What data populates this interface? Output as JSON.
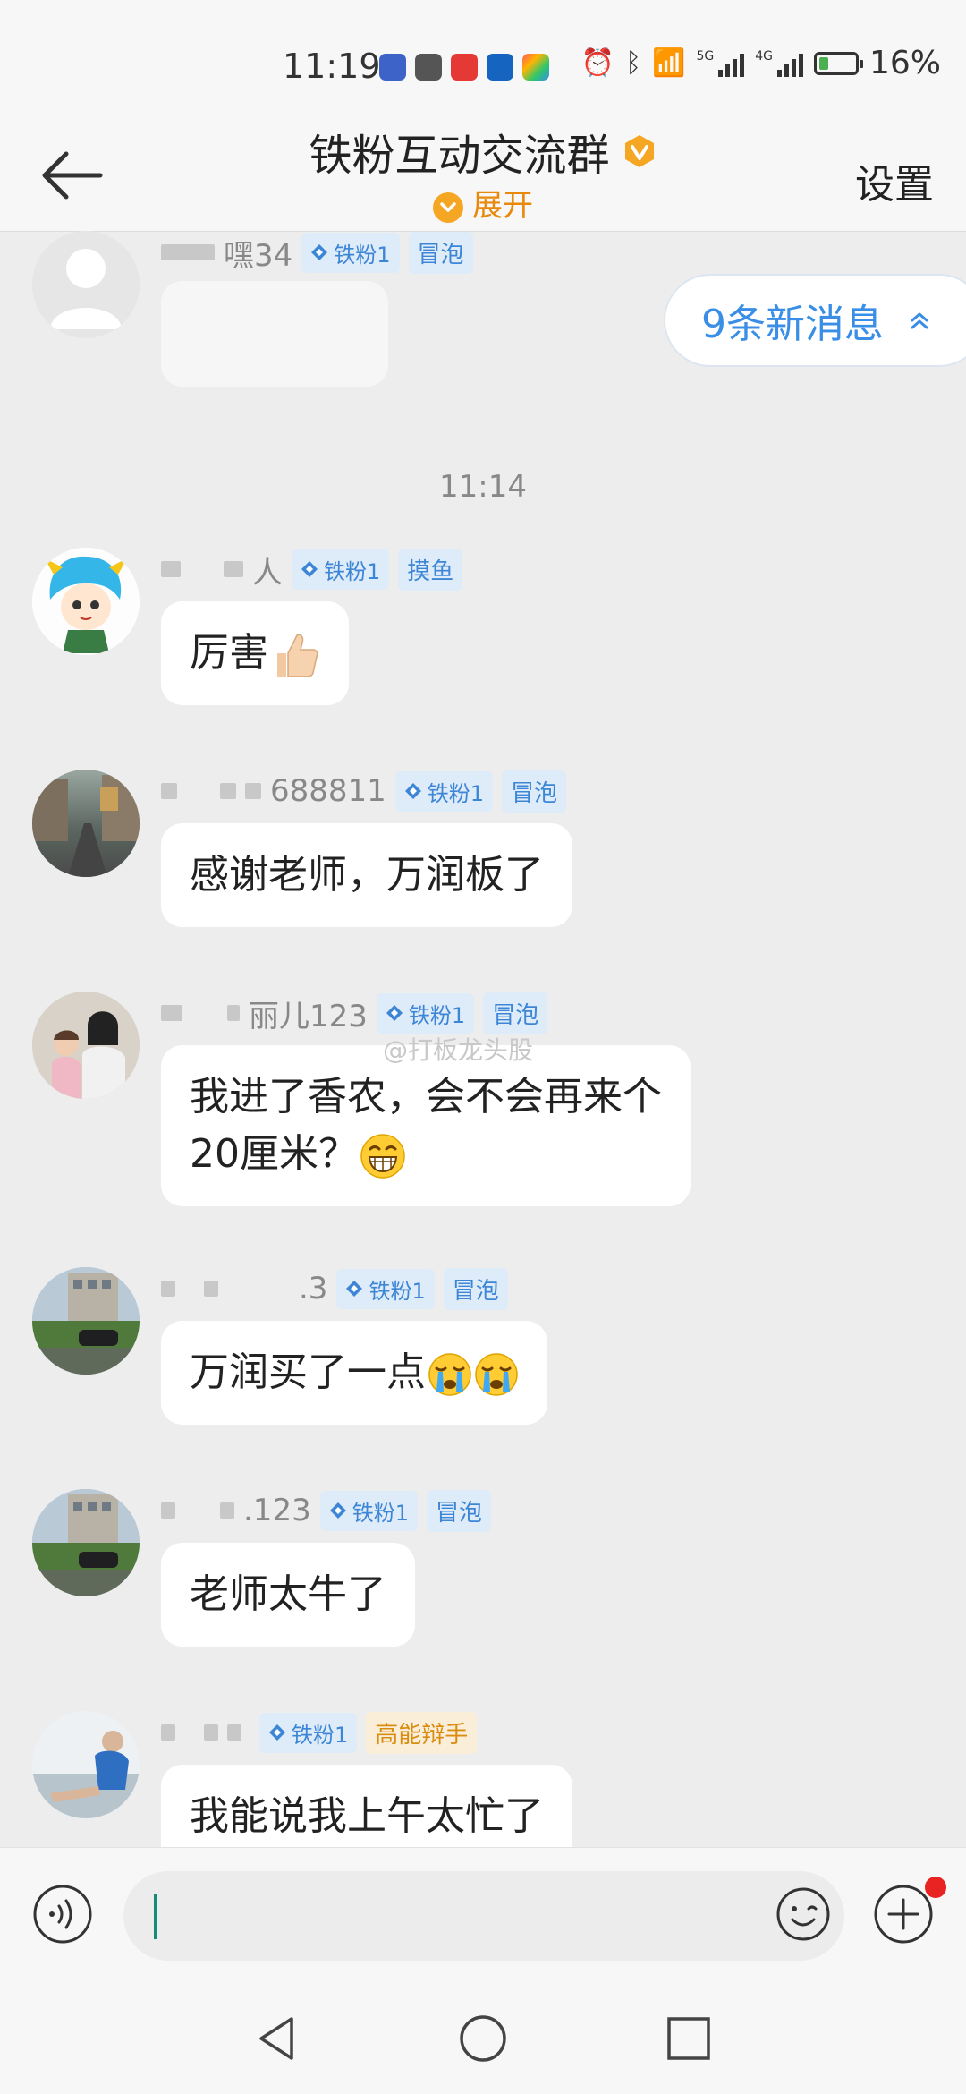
{
  "status_bar": {
    "time": "11:19",
    "app_icons": [
      "bilibili-icon",
      "xiaohongshu-icon",
      "lightbulb-icon",
      "paint-icon",
      "note-icon"
    ],
    "signal_labels": [
      "5G",
      "4G"
    ],
    "battery_percent": "16%",
    "battery_level": 0.16
  },
  "header": {
    "title": "铁粉互动交流群",
    "expand_label": "展开",
    "settings_label": "设置"
  },
  "new_messages": {
    "label": "9条新消息"
  },
  "time_divider": "11:14",
  "watermark": "@打板龙头股",
  "messages": [
    {
      "name_suffix": "嘿34",
      "fan_tag": "铁粉1",
      "role": "冒泡",
      "text": ""
    },
    {
      "name_suffix": "人",
      "fan_tag": "铁粉1",
      "role": "摸鱼",
      "text": "厉害"
    },
    {
      "name_suffix": "688811",
      "fan_tag": "铁粉1",
      "role": "冒泡",
      "text": "感谢老师，万润板了"
    },
    {
      "name_suffix": "丽儿123",
      "fan_tag": "铁粉1",
      "role": "冒泡",
      "text_line1": "我进了香农，会不会再来个",
      "text_line2": "20厘米？"
    },
    {
      "name_suffix": ".3",
      "fan_tag": "铁粉1",
      "role": "冒泡",
      "text": "万润买了一点"
    },
    {
      "name_suffix": ".123",
      "fan_tag": "铁粉1",
      "role": "冒泡",
      "text": "老师太牛了"
    },
    {
      "name_suffix": "",
      "fan_tag": "铁粉1",
      "role": "高能辩手",
      "text": "我能说我上午太忙了"
    }
  ],
  "input": {
    "value": "",
    "placeholder": ""
  },
  "colors": {
    "accent": "#3a8ee6",
    "gold": "#f5a623",
    "badge_red": "#e92222"
  }
}
